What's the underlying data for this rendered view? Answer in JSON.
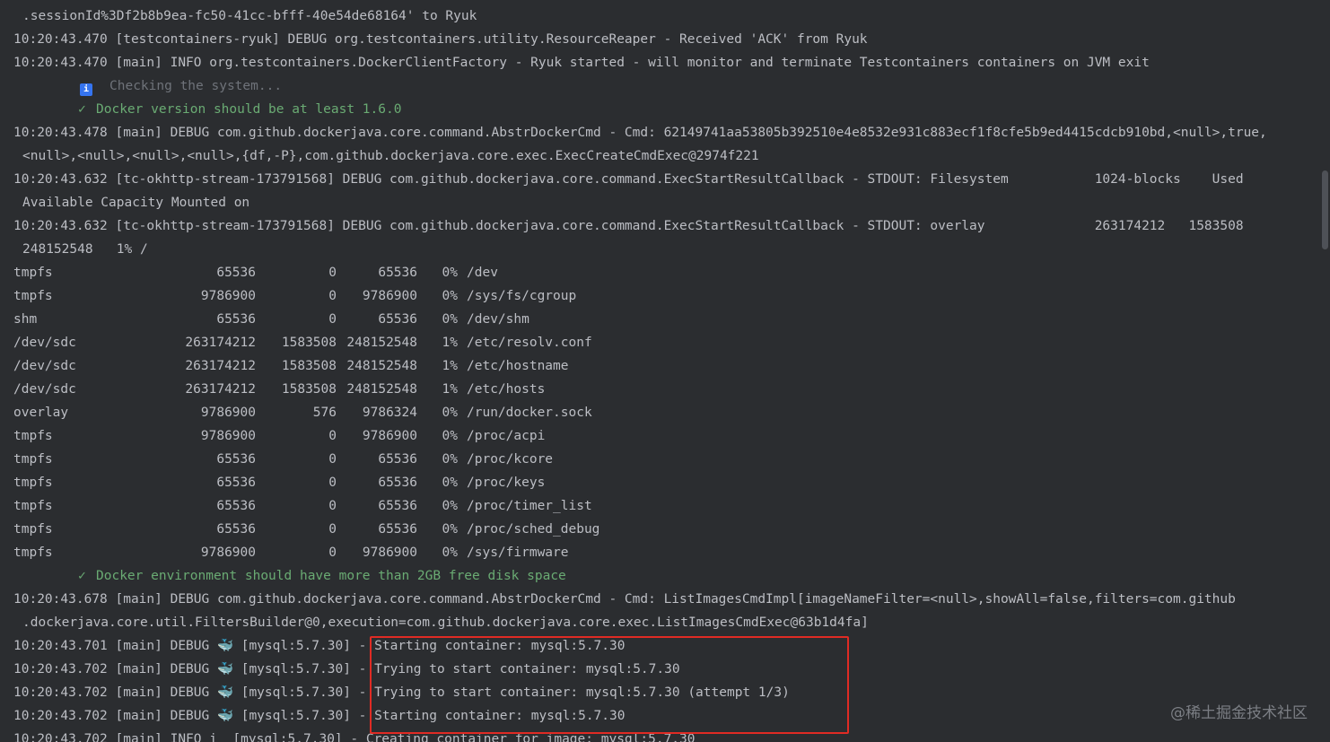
{
  "console": {
    "line_01": ".sessionId%3Df2b8b9ea-fc50-41cc-bfff-40e54de68164' to Ryuk",
    "line_02": "10:20:43.470 [testcontainers-ryuk] DEBUG org.testcontainers.utility.ResourceReaper - Received 'ACK' from Ryuk",
    "line_03": "10:20:43.470 [main] INFO org.testcontainers.DockerClientFactory - Ryuk started - will monitor and terminate Testcontainers containers on JVM exit",
    "checking": {
      "icon": "info-icon",
      "glyph": "i",
      "text": "Checking the system..."
    },
    "check_docker_version": {
      "icon": "checkmark-icon",
      "glyph": "✓",
      "text": "Docker version should be at least 1.6.0"
    },
    "line_06": "10:20:43.478 [main] DEBUG com.github.dockerjava.core.command.AbstrDockerCmd - Cmd: 62149741aa53805b392510e4e8532e931c883ecf1f8cfe5b9ed4415cdcb910bd,<null>,true,",
    "line_07": "<null>,<null>,<null>,<null>,{df,-P},com.github.dockerjava.core.exec.ExecCreateCmdExec@2974f221",
    "line_08": "10:20:43.632 [tc-okhttp-stream-173791568] DEBUG com.github.dockerjava.core.command.ExecStartResultCallback - STDOUT: Filesystem           1024-blocks    Used",
    "line_09": "Available Capacity Mounted on",
    "line_10": "10:20:43.632 [tc-okhttp-stream-173791568] DEBUG com.github.dockerjava.core.command.ExecStartResultCallback - STDOUT: overlay              263174212   1583508",
    "line_11": "248152548   1% /",
    "df_rows": [
      {
        "fs": "tmpfs",
        "blocks": "65536",
        "used": "0",
        "avail": "65536",
        "cap": "0%",
        "mount": "/dev"
      },
      {
        "fs": "tmpfs",
        "blocks": "9786900",
        "used": "0",
        "avail": "9786900",
        "cap": "0%",
        "mount": "/sys/fs/cgroup"
      },
      {
        "fs": "shm",
        "blocks": "65536",
        "used": "0",
        "avail": "65536",
        "cap": "0%",
        "mount": "/dev/shm"
      },
      {
        "fs": "/dev/sdc",
        "blocks": "263174212",
        "used": "1583508",
        "avail": "248152548",
        "cap": "1%",
        "mount": "/etc/resolv.conf"
      },
      {
        "fs": "/dev/sdc",
        "blocks": "263174212",
        "used": "1583508",
        "avail": "248152548",
        "cap": "1%",
        "mount": "/etc/hostname"
      },
      {
        "fs": "/dev/sdc",
        "blocks": "263174212",
        "used": "1583508",
        "avail": "248152548",
        "cap": "1%",
        "mount": "/etc/hosts"
      },
      {
        "fs": "overlay",
        "blocks": "9786900",
        "used": "576",
        "avail": "9786324",
        "cap": "0%",
        "mount": "/run/docker.sock"
      },
      {
        "fs": "tmpfs",
        "blocks": "9786900",
        "used": "0",
        "avail": "9786900",
        "cap": "0%",
        "mount": "/proc/acpi"
      },
      {
        "fs": "tmpfs",
        "blocks": "65536",
        "used": "0",
        "avail": "65536",
        "cap": "0%",
        "mount": "/proc/kcore"
      },
      {
        "fs": "tmpfs",
        "blocks": "65536",
        "used": "0",
        "avail": "65536",
        "cap": "0%",
        "mount": "/proc/keys"
      },
      {
        "fs": "tmpfs",
        "blocks": "65536",
        "used": "0",
        "avail": "65536",
        "cap": "0%",
        "mount": "/proc/timer_list"
      },
      {
        "fs": "tmpfs",
        "blocks": "65536",
        "used": "0",
        "avail": "65536",
        "cap": "0%",
        "mount": "/proc/sched_debug"
      },
      {
        "fs": "tmpfs",
        "blocks": "9786900",
        "used": "0",
        "avail": "9786900",
        "cap": "0%",
        "mount": "/sys/firmware"
      }
    ],
    "check_disk_space": {
      "icon": "checkmark-icon",
      "glyph": "✓",
      "text": "Docker environment should have more than 2GB free disk space"
    },
    "line_26": "10:20:43.678 [main] DEBUG com.github.dockerjava.core.command.AbstrDockerCmd - Cmd: ListImagesCmdImpl[imageNameFilter=<null>,showAll=false,filters=com.github",
    "line_27": ".dockerjava.core.util.FiltersBuilder@0,execution=com.github.dockerjava.core.exec.ListImagesCmdExec@63b1d4fa]",
    "container_lines": [
      {
        "prefix": "10:20:43.701 [main] DEBUG",
        "icon": "docker-whale-icon",
        "glyph": "🐳",
        "tag": "[mysql:5.7.30] - ",
        "message": "Starting container: mysql:5.7.30"
      },
      {
        "prefix": "10:20:43.702 [main] DEBUG",
        "icon": "docker-whale-icon",
        "glyph": "🐳",
        "tag": "[mysql:5.7.30] - ",
        "message": "Trying to start container: mysql:5.7.30"
      },
      {
        "prefix": "10:20:43.702 [main] DEBUG",
        "icon": "docker-whale-icon",
        "glyph": "🐳",
        "tag": "[mysql:5.7.30] - ",
        "message": "Trying to start container: mysql:5.7.30 (attempt 1/3)"
      },
      {
        "prefix": "10:20:43.702 [main] DEBUG",
        "icon": "docker-whale-icon",
        "glyph": "🐳",
        "tag": "[mysql:5.7.30] - ",
        "message": "Starting container: mysql:5.7.30"
      }
    ],
    "line_cut_off": "10:20:43.702 [main] INFO i  [mysql:5.7.30] - Creating container for image: mysql:5.7.30"
  },
  "highlight_color": "#e02b24",
  "watermark": "@稀土掘金技术社区"
}
